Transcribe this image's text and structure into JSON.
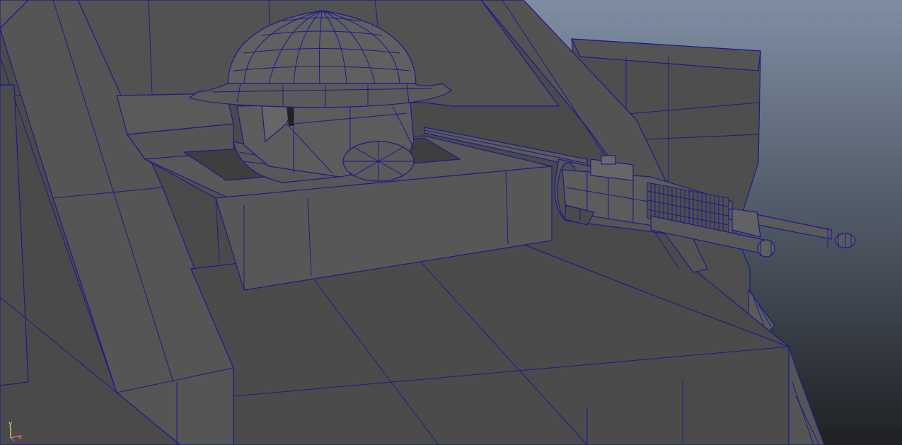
{
  "viewport": {
    "background_top": "#7f8ea3",
    "background_bottom": "#1f2124",
    "mesh_fill": "#4a4a4a",
    "wire_color": "#1c1a8c"
  },
  "axis_indicator": {
    "y_label": "y",
    "x_label": "x",
    "y_color": "#e8e86a",
    "x_color": "#ff7070",
    "z_color": "#6a7cff"
  }
}
